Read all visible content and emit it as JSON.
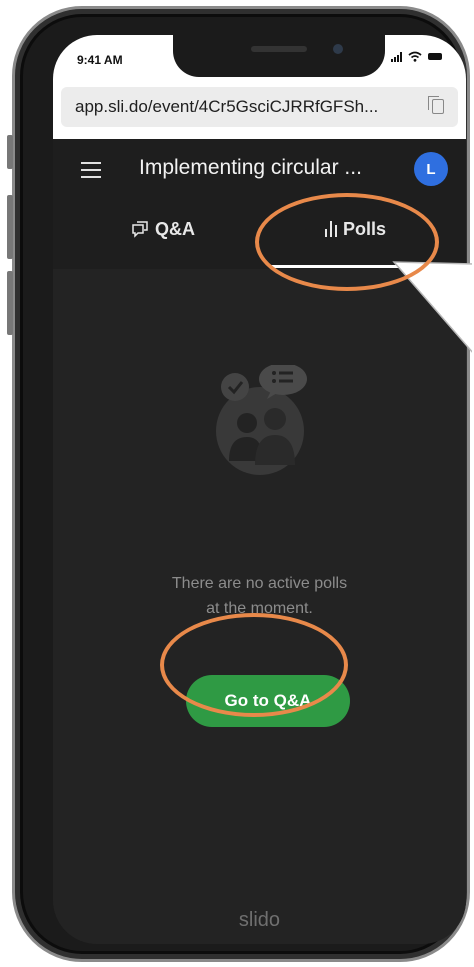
{
  "status_bar": {
    "time": "9:41 AM"
  },
  "browser": {
    "url": "app.sli.do/event/4Cr5GsciCJRRfGFSh..."
  },
  "header": {
    "title": "Implementing circular ...",
    "avatar_initial": "L"
  },
  "tabs": [
    {
      "label": "Q&A",
      "active": false
    },
    {
      "label": "Polls",
      "active": true
    }
  ],
  "empty_state": {
    "line1": "There are no active polls",
    "line2": "at the moment."
  },
  "actions": {
    "go_to_qa": "Go to Q&A"
  },
  "footer": {
    "logo": "slido"
  },
  "colors": {
    "primary_green": "#2f9a44",
    "avatar_blue": "#2f6fe0",
    "annotation_orange": "#e8894a",
    "app_background": "#232323"
  }
}
